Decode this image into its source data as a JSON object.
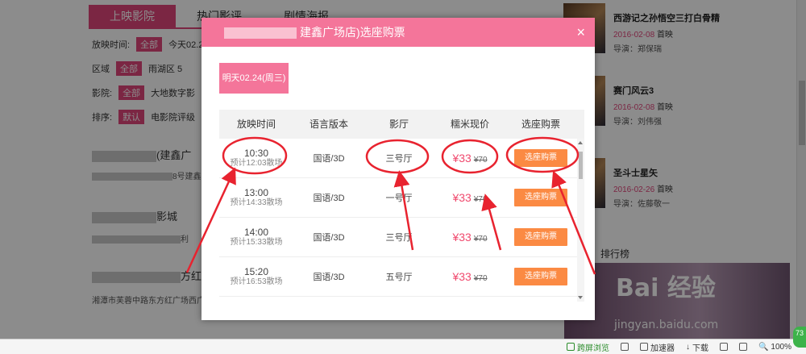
{
  "background": {
    "tabs": [
      "上映影院",
      "热门影评",
      "剧情海报"
    ],
    "filters": {
      "showtime_label": "放映时间:",
      "showtime_all": "全部",
      "showtime_today": "今天02.2",
      "area_label": "区域",
      "area_all": "全部",
      "area_item": "雨湖区 5",
      "cinema_label": "影院:",
      "cinema_all": "全部",
      "cinema_item": "大地数字影",
      "sort_label": "排序:",
      "sort_default": "默认",
      "sort_item": "电影院评级"
    },
    "cinemas": [
      {
        "name": "(建鑫广",
        "address": "8号建鑫"
      },
      {
        "name": "影城",
        "address": "利"
      },
      {
        "name": "方红",
        "address": "湘潭市芙蓉中路东方红广场西广"
      }
    ],
    "films": [
      {
        "title": "西游记之孙悟空三打白骨精",
        "date": "2016-02-08",
        "tag": "首映",
        "director": "导演：郑保瑞"
      },
      {
        "title": "赛门风云3",
        "date": "2016-02-08",
        "tag": "首映",
        "director": "导演：刘伟强"
      },
      {
        "title": "圣斗士星矢",
        "date": "2016-02-26",
        "tag": "首映",
        "director": "导演：佐藤敬一"
      }
    ],
    "rank_title": "排行榜",
    "watermark": "Bai 经验",
    "watermark_sub": "jingyan.baidu.com"
  },
  "modal": {
    "title": "建鑫广场店)选座购票",
    "close": "×",
    "date_tab": "明天02.24(周三)",
    "columns": [
      "放映时间",
      "语言版本",
      "影厅",
      "糯米现价",
      "选座购票"
    ],
    "rows": [
      {
        "time": "10:30",
        "end": "预计12:03散场",
        "lang": "国语/3D",
        "hall": "三号厅",
        "price": "¥33",
        "old_price": "¥70",
        "button": "选座购票"
      },
      {
        "time": "13:00",
        "end": "预计14:33散场",
        "lang": "国语/3D",
        "hall": "一号厅",
        "price": "¥33",
        "old_price": "¥70",
        "button": "选座购票"
      },
      {
        "time": "14:00",
        "end": "预计15:33散场",
        "lang": "国语/3D",
        "hall": "三号厅",
        "price": "¥33",
        "old_price": "¥70",
        "button": "选座购票"
      },
      {
        "time": "15:20",
        "end": "预计16:53散场",
        "lang": "国语/3D",
        "hall": "五号厅",
        "price": "¥33",
        "old_price": "¥70",
        "button": "选座购票"
      }
    ]
  },
  "statusbar": {
    "phone": "跨屏浏览",
    "accelerator": "加速器",
    "download": "下载",
    "zoom": "100%",
    "badge": "73"
  },
  "colors": {
    "brand_pink": "#f4759a",
    "tab_pink": "#e0457b",
    "price_red": "#f04a6e",
    "button_orange": "#fb8a43",
    "annotation_red": "#e8232f"
  }
}
